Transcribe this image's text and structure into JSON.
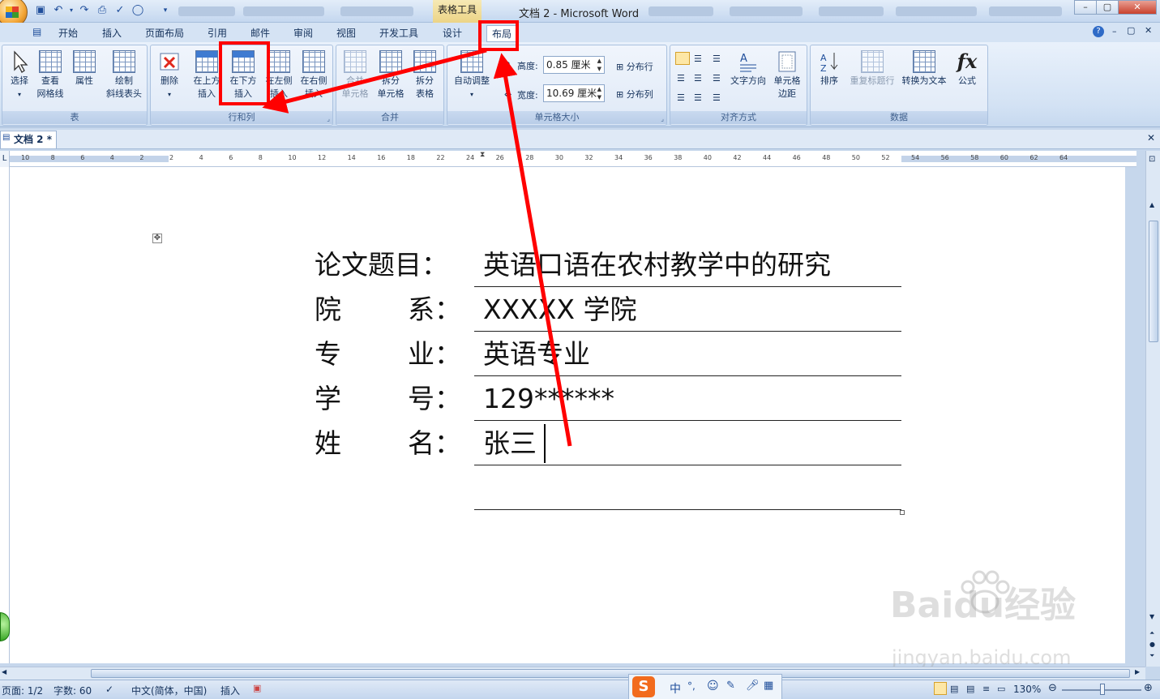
{
  "titlebar": {
    "context_tab": "表格工具",
    "title": "文档 2 - Microsoft Word"
  },
  "tabs": [
    "开始",
    "插入",
    "页面布局",
    "引用",
    "邮件",
    "审阅",
    "视图",
    "开发工具",
    "设计",
    "布局"
  ],
  "ribbon": {
    "groups": {
      "table": "表",
      "rows_cols": "行和列",
      "merge": "合并",
      "cell_size": "单元格大小",
      "alignment": "对齐方式",
      "data": "数据"
    },
    "select": "选择",
    "view_gridlines": [
      "查看",
      "网格线"
    ],
    "properties": "属性",
    "draw_diagonal": [
      "绘制",
      "斜线表头"
    ],
    "delete": "删除",
    "insert_above": [
      "在上方",
      "插入"
    ],
    "insert_below": [
      "在下方",
      "插入"
    ],
    "insert_left": [
      "在左侧",
      "插入"
    ],
    "insert_right": [
      "在右侧",
      "插入"
    ],
    "merge_cells": [
      "合并",
      "单元格"
    ],
    "split_cells": [
      "拆分",
      "单元格"
    ],
    "split_table": [
      "拆分",
      "表格"
    ],
    "autofit": "自动调整",
    "height_label": "高度:",
    "height_value": "0.85 厘米",
    "width_label": "宽度:",
    "width_value": "10.69 厘米",
    "distribute_rows": "分布行",
    "distribute_cols": "分布列",
    "text_direction": "文字方向",
    "cell_margins": [
      "单元格",
      "边距"
    ],
    "sort": "排序",
    "repeat_header": "重复标题行",
    "convert_to_text": "转换为文本",
    "formula": "公式"
  },
  "doc_tab": "文档 2 *",
  "ruler_ticks": [
    "10",
    "8",
    "6",
    "4",
    "2",
    "2",
    "4",
    "6",
    "8",
    "10",
    "12",
    "14",
    "16",
    "18",
    "22",
    "24",
    "26",
    "28",
    "30",
    "32",
    "34",
    "36",
    "38",
    "40",
    "42",
    "44",
    "46",
    "48",
    "50",
    "52",
    "54",
    "56",
    "58",
    "60",
    "62",
    "64"
  ],
  "form": [
    {
      "label1": "论文题目：",
      "label2": "",
      "value": "英语口语在农村教学中的研究"
    },
    {
      "label1": "院",
      "label2": "系：",
      "value": "XXXXX 学院"
    },
    {
      "label1": "专",
      "label2": "业：",
      "value": "英语专业"
    },
    {
      "label1": "学",
      "label2": "号：",
      "value": "129******"
    },
    {
      "label1": "姓",
      "label2": "名：",
      "value": "张三"
    }
  ],
  "status": {
    "page": "页面: 1/2",
    "words": "字数: 60",
    "language": "中文(简体，中国)",
    "mode": "插入",
    "zoom": "130%"
  },
  "ime": {
    "lang": "中",
    "punct": "°,"
  },
  "watermark": {
    "brand": "Baidu经验",
    "url": "jingyan.baidu.com"
  },
  "colors": {
    "highlight": "#ff0000",
    "ribbon": "#d3e2f4"
  }
}
